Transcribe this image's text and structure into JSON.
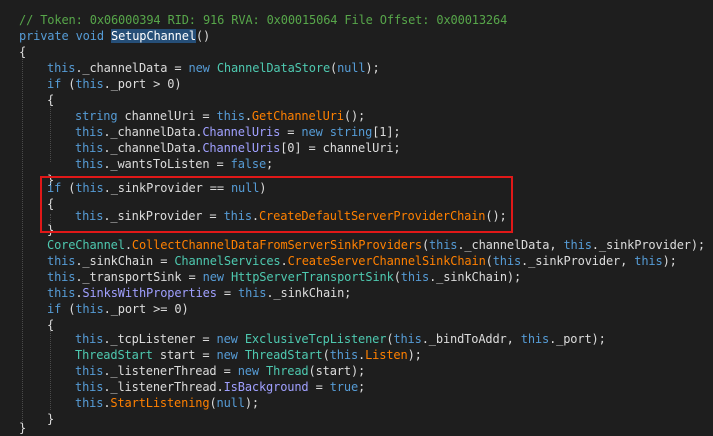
{
  "header_comment": "// Token: 0x06000394 RID: 916 RVA: 0x00015064 File Offset: 0x00013264",
  "lines": [
    {
      "tokens": [
        {
          "t": "private",
          "c": "kw"
        },
        {
          "t": " "
        },
        {
          "t": "void",
          "c": "kw"
        },
        {
          "t": " "
        },
        {
          "t": "SetupChannel",
          "c": "sel"
        },
        {
          "t": "()"
        }
      ]
    },
    {
      "tokens": [
        {
          "t": "{"
        }
      ]
    },
    {
      "tokens": [
        {
          "t": "this",
          "c": "kw"
        },
        {
          "t": "._channelData = "
        },
        {
          "t": "new",
          "c": "kw"
        },
        {
          "t": " "
        },
        {
          "t": "ChannelDataStore",
          "c": "ty"
        },
        {
          "t": "("
        },
        {
          "t": "null",
          "c": "kw"
        },
        {
          "t": ");"
        }
      ]
    },
    {
      "tokens": [
        {
          "t": "if",
          "c": "kw"
        },
        {
          "t": " ("
        },
        {
          "t": "this",
          "c": "kw"
        },
        {
          "t": "._port > 0)"
        }
      ]
    },
    {
      "tokens": [
        {
          "t": "{"
        }
      ]
    },
    {
      "tokens": [
        {
          "t": "string",
          "c": "kw"
        },
        {
          "t": " channelUri = "
        },
        {
          "t": "this",
          "c": "kw"
        },
        {
          "t": "."
        },
        {
          "t": "GetChannelUri",
          "c": "mt"
        },
        {
          "t": "();"
        }
      ]
    },
    {
      "tokens": [
        {
          "t": "this",
          "c": "kw"
        },
        {
          "t": "._channelData."
        },
        {
          "t": "ChannelUris",
          "c": "pr"
        },
        {
          "t": " = "
        },
        {
          "t": "new",
          "c": "kw"
        },
        {
          "t": " "
        },
        {
          "t": "string",
          "c": "kw"
        },
        {
          "t": "[1];"
        }
      ]
    },
    {
      "tokens": [
        {
          "t": "this",
          "c": "kw"
        },
        {
          "t": "._channelData."
        },
        {
          "t": "ChannelUris",
          "c": "pr"
        },
        {
          "t": "[0] = channelUri;"
        }
      ]
    },
    {
      "tokens": [
        {
          "t": "this",
          "c": "kw"
        },
        {
          "t": "._wantsToListen = "
        },
        {
          "t": "false",
          "c": "kw"
        },
        {
          "t": ";"
        }
      ]
    },
    {
      "tokens": [
        {
          "t": "}"
        }
      ]
    },
    {
      "tokens": [
        {
          "t": "if",
          "c": "kw"
        },
        {
          "t": " ("
        },
        {
          "t": "this",
          "c": "kw"
        },
        {
          "t": "._sinkProvider == "
        },
        {
          "t": "null",
          "c": "kw"
        },
        {
          "t": ")"
        }
      ]
    },
    {
      "tokens": [
        {
          "t": "{"
        }
      ]
    },
    {
      "tokens": [
        {
          "t": "this",
          "c": "kw"
        },
        {
          "t": "._sinkProvider = "
        },
        {
          "t": "this",
          "c": "kw"
        },
        {
          "t": "."
        },
        {
          "t": "CreateDefaultServerProviderChain",
          "c": "mt"
        },
        {
          "t": "();"
        }
      ]
    },
    {
      "tokens": [
        {
          "t": "}"
        }
      ]
    },
    {
      "tokens": [
        {
          "t": "CoreChannel",
          "c": "ty"
        },
        {
          "t": "."
        },
        {
          "t": "CollectChannelDataFromServerSinkProviders",
          "c": "mt"
        },
        {
          "t": "("
        },
        {
          "t": "this",
          "c": "kw"
        },
        {
          "t": "._channelData, "
        },
        {
          "t": "this",
          "c": "kw"
        },
        {
          "t": "._sinkProvider);"
        }
      ]
    },
    {
      "tokens": [
        {
          "t": "this",
          "c": "kw"
        },
        {
          "t": "._sinkChain = "
        },
        {
          "t": "ChannelServices",
          "c": "ty"
        },
        {
          "t": "."
        },
        {
          "t": "CreateServerChannelSinkChain",
          "c": "mt"
        },
        {
          "t": "("
        },
        {
          "t": "this",
          "c": "kw"
        },
        {
          "t": "._sinkProvider, "
        },
        {
          "t": "this",
          "c": "kw"
        },
        {
          "t": ");"
        }
      ]
    },
    {
      "tokens": [
        {
          "t": "this",
          "c": "kw"
        },
        {
          "t": "._transportSink = "
        },
        {
          "t": "new",
          "c": "kw"
        },
        {
          "t": " "
        },
        {
          "t": "HttpServerTransportSink",
          "c": "ty"
        },
        {
          "t": "("
        },
        {
          "t": "this",
          "c": "kw"
        },
        {
          "t": "._sinkChain);"
        }
      ]
    },
    {
      "tokens": [
        {
          "t": "this",
          "c": "kw"
        },
        {
          "t": "."
        },
        {
          "t": "SinksWithProperties",
          "c": "pr"
        },
        {
          "t": " = "
        },
        {
          "t": "this",
          "c": "kw"
        },
        {
          "t": "._sinkChain;"
        }
      ]
    },
    {
      "tokens": [
        {
          "t": "if",
          "c": "kw"
        },
        {
          "t": " ("
        },
        {
          "t": "this",
          "c": "kw"
        },
        {
          "t": "._port >= 0)"
        }
      ]
    },
    {
      "tokens": [
        {
          "t": "{"
        }
      ]
    },
    {
      "tokens": [
        {
          "t": "this",
          "c": "kw"
        },
        {
          "t": "._tcpListener = "
        },
        {
          "t": "new",
          "c": "kw"
        },
        {
          "t": " "
        },
        {
          "t": "ExclusiveTcpListener",
          "c": "ty"
        },
        {
          "t": "("
        },
        {
          "t": "this",
          "c": "kw"
        },
        {
          "t": "._bindToAddr, "
        },
        {
          "t": "this",
          "c": "kw"
        },
        {
          "t": "._port);"
        }
      ]
    },
    {
      "tokens": [
        {
          "t": "ThreadStart",
          "c": "ty"
        },
        {
          "t": " start = "
        },
        {
          "t": "new",
          "c": "kw"
        },
        {
          "t": " "
        },
        {
          "t": "ThreadStart",
          "c": "ty"
        },
        {
          "t": "("
        },
        {
          "t": "this",
          "c": "kw"
        },
        {
          "t": "."
        },
        {
          "t": "Listen",
          "c": "mt"
        },
        {
          "t": ");"
        }
      ]
    },
    {
      "tokens": [
        {
          "t": "this",
          "c": "kw"
        },
        {
          "t": "._listenerThread = "
        },
        {
          "t": "new",
          "c": "kw"
        },
        {
          "t": " "
        },
        {
          "t": "Thread",
          "c": "ty"
        },
        {
          "t": "(start);"
        }
      ]
    },
    {
      "tokens": [
        {
          "t": "this",
          "c": "kw"
        },
        {
          "t": "._listenerThread."
        },
        {
          "t": "IsBackground",
          "c": "pr"
        },
        {
          "t": " = "
        },
        {
          "t": "true",
          "c": "kw"
        },
        {
          "t": ";"
        }
      ]
    },
    {
      "tokens": [
        {
          "t": "this",
          "c": "kw"
        },
        {
          "t": "."
        },
        {
          "t": "StartListening",
          "c": "mt"
        },
        {
          "t": "("
        },
        {
          "t": "null",
          "c": "kw"
        },
        {
          "t": ");"
        }
      ]
    },
    {
      "tokens": [
        {
          "t": "}"
        }
      ]
    },
    {
      "tokens": [
        {
          "t": "}"
        }
      ]
    }
  ]
}
